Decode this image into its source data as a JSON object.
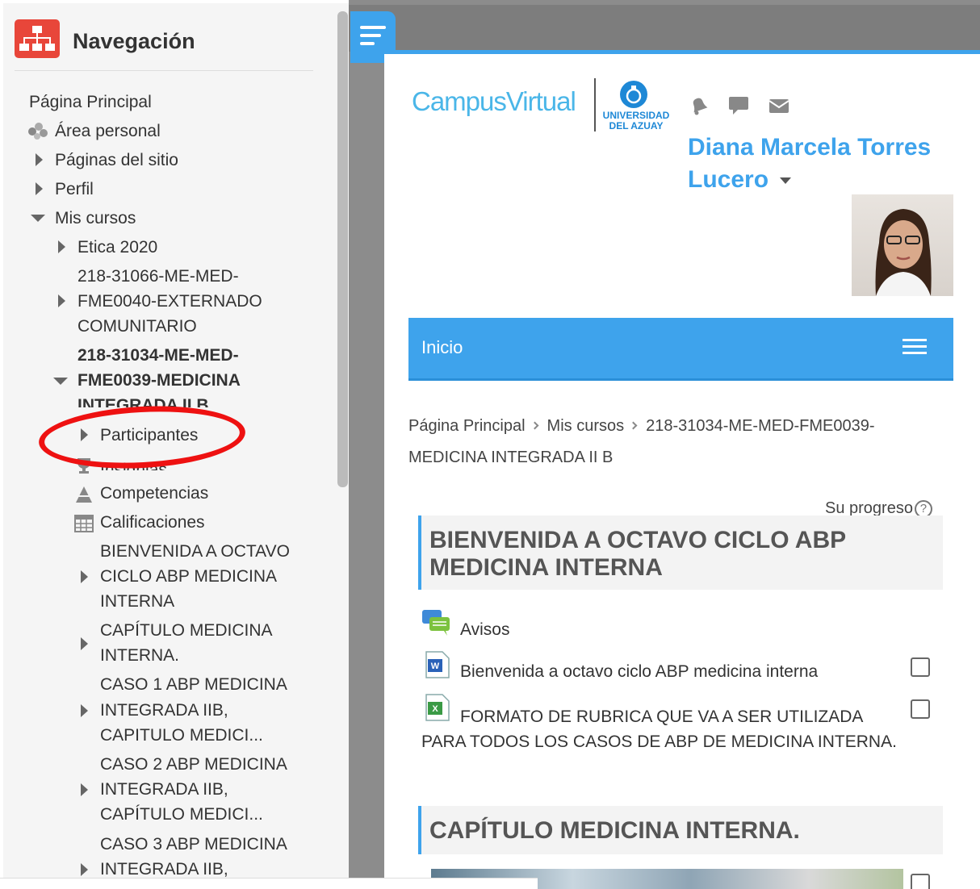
{
  "sidebar": {
    "title": "Navegación",
    "items": [
      {
        "label": "Página Principal"
      },
      {
        "label": "Área personal"
      },
      {
        "label": "Páginas del sitio"
      },
      {
        "label": "Perfil"
      },
      {
        "label": "Mis cursos"
      },
      {
        "label": "Etica 2020"
      },
      {
        "label": "218-31066-ME-MED-"
      },
      {
        "label": "FME0040-EXTERNADO"
      },
      {
        "label": "COMUNITARIO"
      },
      {
        "label": "218-31034-ME-MED-"
      },
      {
        "label": "FME0039-MEDICINA"
      },
      {
        "label": "INTEGRADA II B"
      },
      {
        "label": "Participantes"
      },
      {
        "label": "Insignias"
      },
      {
        "label": "Competencias"
      },
      {
        "label": "Calificaciones"
      },
      {
        "label": "BIENVENIDA A OCTAVO"
      },
      {
        "label": "CICLO ABP MEDICINA"
      },
      {
        "label": "INTERNA"
      },
      {
        "label": "CAPÍTULO MEDICINA"
      },
      {
        "label": "INTERNA."
      },
      {
        "label": "CASO 1 ABP MEDICINA"
      },
      {
        "label": "INTEGRADA IIB,"
      },
      {
        "label": "CAPITULO MEDICI..."
      },
      {
        "label": "CASO 2 ABP MEDICINA"
      },
      {
        "label": "INTEGRADA IIB,"
      },
      {
        "label": "CAPÍTULO MEDICI..."
      },
      {
        "label": "CASO 3 ABP MEDICINA"
      },
      {
        "label": "INTEGRADA IIB,"
      }
    ]
  },
  "header": {
    "logo_text": "CampusVirtual",
    "university": "UNIVERSIDAD DEL AZUAY",
    "user_name": "Diana Marcela Torres Lucero",
    "icons": [
      "bell-icon",
      "chat-icon",
      "mail-icon"
    ]
  },
  "nav_bar": {
    "label": "Inicio"
  },
  "breadcrumb": {
    "items": [
      "Página Principal",
      "Mis cursos",
      "218-31034-ME-MED-FME0039-MEDICINA INTEGRADA II B"
    ]
  },
  "progress": {
    "label": "Su progreso",
    "help": "?"
  },
  "sections": [
    {
      "title": "BIENVENIDA A OCTAVO CICLO ABP MEDICINA INTERNA",
      "activities": [
        {
          "label": "Avisos",
          "icon": "forum-icon"
        },
        {
          "label": "Bienvenida a octavo ciclo ABP medicina interna",
          "icon": "word-doc-icon"
        },
        {
          "label": "FORMATO DE RUBRICA QUE VA A SER UTILIZADA PARA TODOS LOS CASOS DE ABP DE MEDICINA INTERNA.",
          "icon": "excel-doc-icon"
        }
      ]
    },
    {
      "title": "CAPÍTULO MEDICINA INTERNA."
    }
  ],
  "colors": {
    "accent": "#3ea3ec",
    "logo_red": "#e8463a",
    "highlight_circle": "#ee1111"
  }
}
